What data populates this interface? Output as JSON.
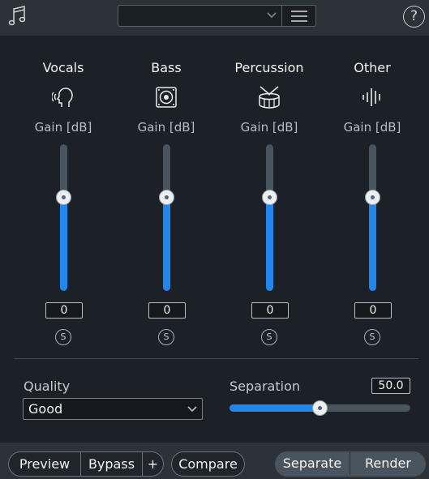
{
  "header": {
    "app_icon": "music-note-icon",
    "preset_value": "",
    "menu_icon": "hamburger-menu-icon",
    "help_label": "?"
  },
  "channels": [
    {
      "title": "Vocals",
      "icon": "head-singing-icon",
      "gain_label": "Gain [dB]",
      "gain_value": "0",
      "solo_label": "S",
      "level": 0.64
    },
    {
      "title": "Bass",
      "icon": "speaker-icon",
      "gain_label": "Gain [dB]",
      "gain_value": "0",
      "solo_label": "S",
      "level": 0.64
    },
    {
      "title": "Percussion",
      "icon": "drum-icon",
      "gain_label": "Gain [dB]",
      "gain_value": "0",
      "solo_label": "S",
      "level": 0.64
    },
    {
      "title": "Other",
      "icon": "waveform-icon",
      "gain_label": "Gain [dB]",
      "gain_value": "0",
      "solo_label": "S",
      "level": 0.64
    }
  ],
  "quality": {
    "label": "Quality",
    "value": "Good"
  },
  "separation": {
    "label": "Separation",
    "value": "50.0",
    "level": 0.5
  },
  "footer": {
    "preview": "Preview",
    "bypass": "Bypass",
    "add": "+",
    "compare": "Compare",
    "separate": "Separate",
    "render": "Render"
  },
  "colors": {
    "accent": "#1e88f0",
    "background": "#1b2127",
    "bar": "#2b3238"
  }
}
